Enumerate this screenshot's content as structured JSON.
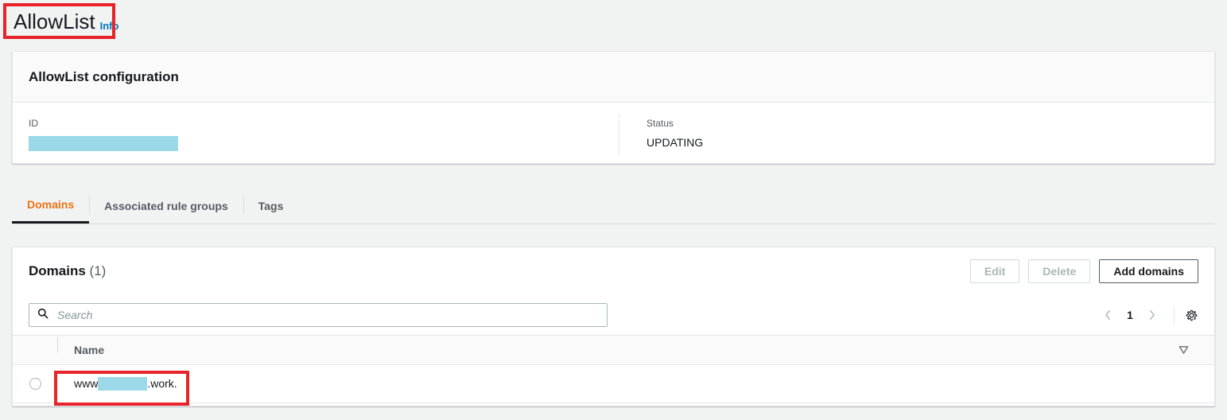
{
  "page": {
    "title": "AllowList",
    "info_link": "Info"
  },
  "config_card": {
    "title": "AllowList configuration",
    "fields": [
      {
        "label": "ID",
        "value": "",
        "redacted": true
      },
      {
        "label": "Status",
        "value": "UPDATING",
        "redacted": false
      }
    ]
  },
  "tabs": [
    {
      "label": "Domains",
      "active": true
    },
    {
      "label": "Associated rule groups",
      "active": false
    },
    {
      "label": "Tags",
      "active": false
    }
  ],
  "domains_panel": {
    "title": "Domains",
    "count": "(1)",
    "buttons": {
      "edit": "Edit",
      "delete": "Delete",
      "add_domains": "Add domains"
    },
    "search": {
      "placeholder": "Search",
      "value": "",
      "icon": "search-icon"
    },
    "pagination": {
      "prev_icon": "chevron-left-icon",
      "page": "1",
      "next_icon": "chevron-right-icon",
      "settings_icon": "gear-icon"
    },
    "table": {
      "columns": [
        "Name"
      ],
      "sort_icon": "filter-triangle-icon",
      "rows": [
        {
          "selected": false,
          "name_prefix": "www",
          "name_redacted": true,
          "name_suffix": ".work."
        }
      ]
    }
  },
  "annotations": {
    "title_highlight": "red-box-around-page-title",
    "domain_highlight": "red-box-around-domain-name"
  },
  "colors": {
    "accent_orange": "#ec7211",
    "link_blue": "#0073bb",
    "redaction_blue": "#9bd8e8",
    "annotation_red": "#e8242a",
    "page_background": "#f1f3f3"
  }
}
